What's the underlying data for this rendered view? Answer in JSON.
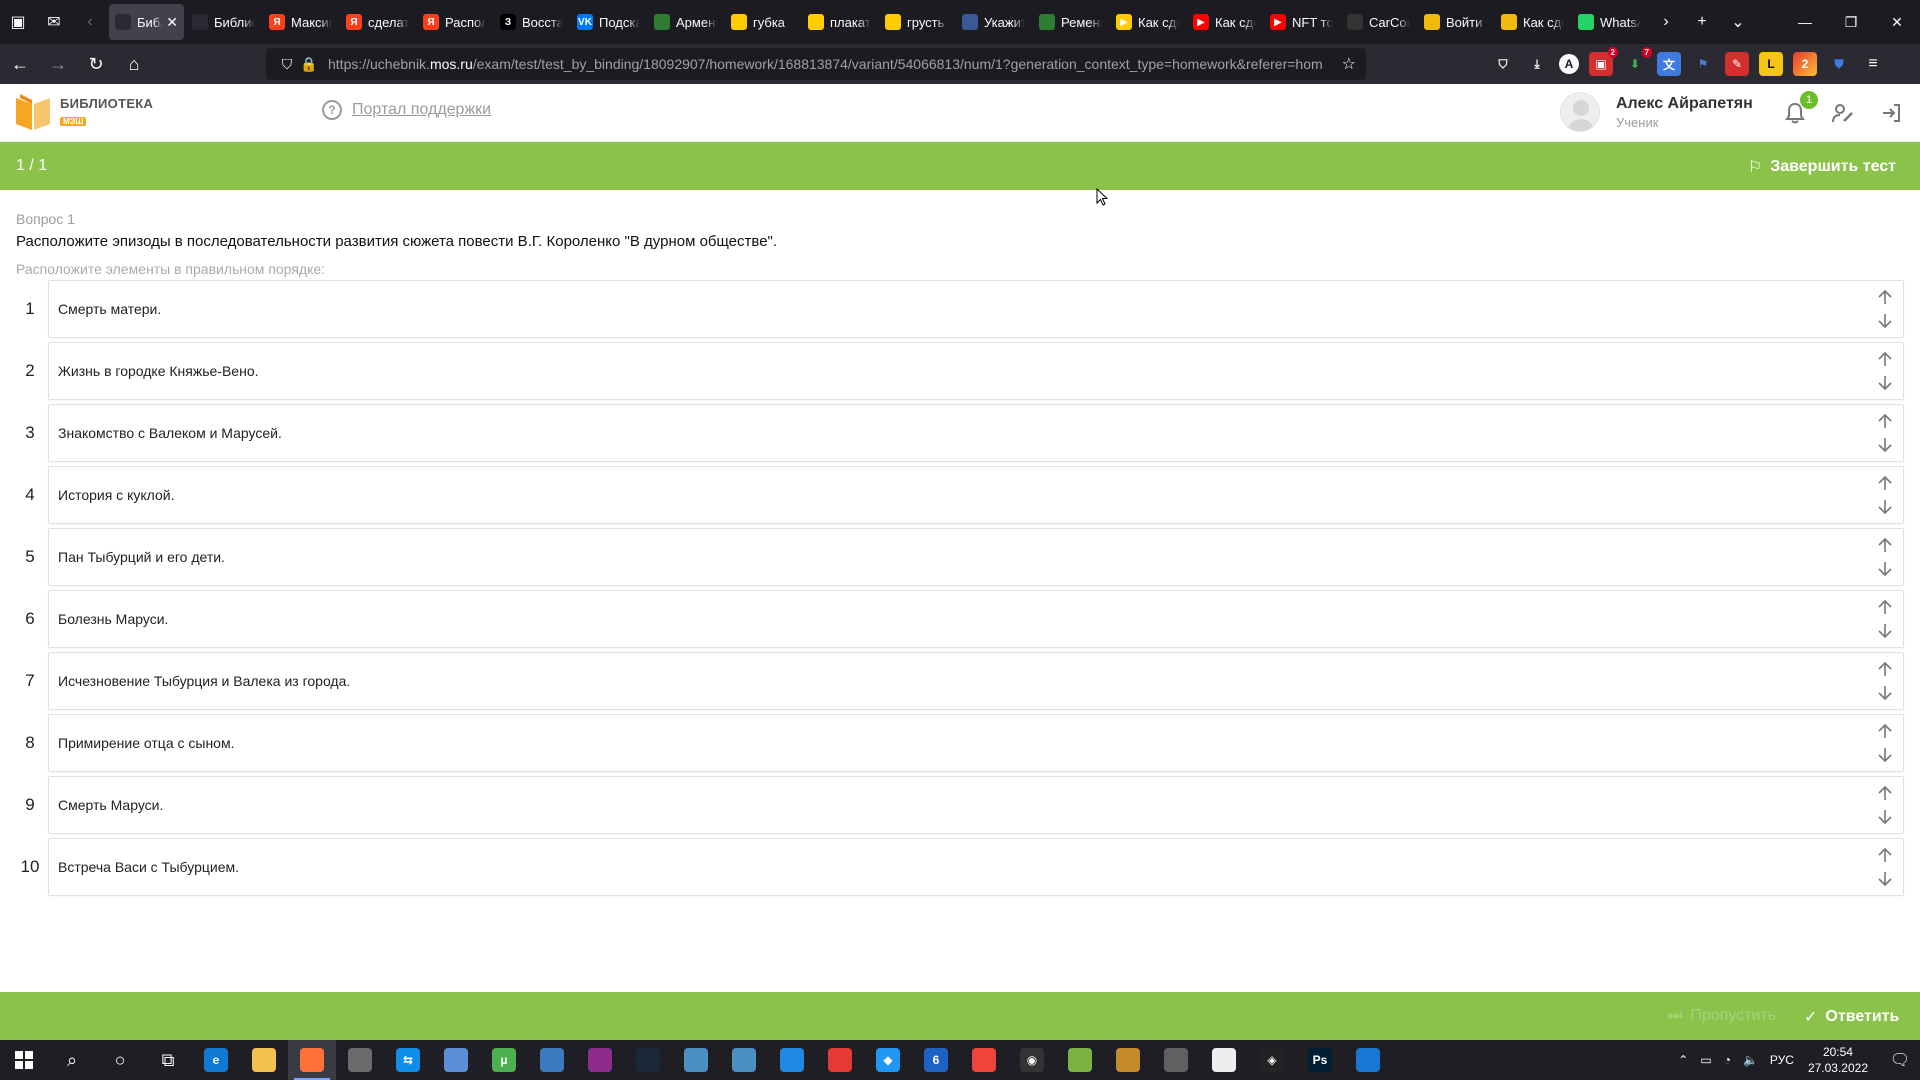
{
  "browser": {
    "tabs": [
      {
        "title": "Библиотека МЭШ",
        "color": "#2a2a35",
        "glyph": "",
        "active": true
      },
      {
        "title": "Библиотека",
        "color": "#2a2a35",
        "glyph": "",
        "active": false
      },
      {
        "title": "Максим",
        "color": "#fc3f1d",
        "glyph": "Я",
        "active": false
      },
      {
        "title": "сделать",
        "color": "#fc3f1d",
        "glyph": "Я",
        "active": false
      },
      {
        "title": "Расположите",
        "color": "#fc3f1d",
        "glyph": "Я",
        "active": false
      },
      {
        "title": "Восстановите",
        "color": "#000000",
        "glyph": "З",
        "active": false
      },
      {
        "title": "Подскажите",
        "color": "#0077ff",
        "glyph": "VK",
        "active": false
      },
      {
        "title": "Армения",
        "color": "#2e7d32",
        "glyph": "",
        "active": false
      },
      {
        "title": "губка",
        "color": "#ffcc00",
        "glyph": "",
        "active": false
      },
      {
        "title": "плакат",
        "color": "#ffcc00",
        "glyph": "",
        "active": false
      },
      {
        "title": "грусть",
        "color": "#ffcc00",
        "glyph": "",
        "active": false
      },
      {
        "title": "Укажите",
        "color": "#3b5998",
        "glyph": "",
        "active": false
      },
      {
        "title": "Ремень",
        "color": "#2e7d32",
        "glyph": "",
        "active": false
      },
      {
        "title": "Как сделать",
        "color": "#ffcc00",
        "glyph": "▶",
        "active": false
      },
      {
        "title": "Как сделать",
        "color": "#ff0000",
        "glyph": "▶",
        "active": false
      },
      {
        "title": "NFT токены",
        "color": "#ff0000",
        "glyph": "▶",
        "active": false
      },
      {
        "title": "CarConnect",
        "color": "#333333",
        "glyph": "",
        "active": false
      },
      {
        "title": "Войти",
        "color": "#f0b90b",
        "glyph": "",
        "active": false
      },
      {
        "title": "Как сделать",
        "color": "#f0b90b",
        "glyph": "",
        "active": false
      },
      {
        "title": "WhatsApp",
        "color": "#25d366",
        "glyph": "",
        "active": false
      }
    ],
    "url_prefix": "https://uchebnik.",
    "url_domain": "mos.ru",
    "url_rest": "/exam/test/test_by_binding/18092907/homework/168813874/variant/54066813/num/1?generation_context_type=homework&referer=hom",
    "extension_badges": [
      "2",
      "7"
    ]
  },
  "header": {
    "logo_title": "БИБЛИОТЕКА",
    "logo_sub": "МЭШ",
    "support_label": "Портал поддержки",
    "user_name": "Алекс Айрапетян",
    "user_role": "Ученик",
    "notification_count": "1"
  },
  "progress": {
    "counter": "1 / 1",
    "finish_label": "Завершить тест"
  },
  "question": {
    "number_label": "Вопрос 1",
    "text": "Расположите эпизоды в последовательности развития сюжета повести В.Г. Короленко \"В дурном обществе\".",
    "hint": "Расположите элементы в правильном порядке:",
    "items": [
      {
        "num": "1",
        "label": "Смерть матери."
      },
      {
        "num": "2",
        "label": "Жизнь в городке Княжье-Вено."
      },
      {
        "num": "3",
        "label": "Знакомство с Валеком и Марусей."
      },
      {
        "num": "4",
        "label": "История с куклой."
      },
      {
        "num": "5",
        "label": "Пан Тыбурций и его дети."
      },
      {
        "num": "6",
        "label": "Болезнь Маруси."
      },
      {
        "num": "7",
        "label": "Исчезновение Тыбурция и Валека из города."
      },
      {
        "num": "8",
        "label": "Примирение отца с сыном."
      },
      {
        "num": "9",
        "label": "Смерть Маруси."
      },
      {
        "num": "10",
        "label": "Встреча Васи с Тыбурцием."
      }
    ]
  },
  "footer": {
    "skip_label": "Пропустить",
    "answer_label": "Ответить"
  },
  "taskbar": {
    "apps": [
      {
        "name": "search",
        "color": "transparent",
        "glyph": "⌕"
      },
      {
        "name": "cortana",
        "color": "transparent",
        "glyph": "○"
      },
      {
        "name": "task-view",
        "color": "transparent",
        "glyph": "⧉"
      },
      {
        "name": "edge",
        "color": "#0f7ad6",
        "glyph": "e"
      },
      {
        "name": "explorer",
        "color": "#f2c14e",
        "glyph": ""
      },
      {
        "name": "firefox",
        "color": "#ff7139",
        "glyph": "",
        "active": true
      },
      {
        "name": "app-1",
        "color": "#6b6b6b",
        "glyph": ""
      },
      {
        "name": "teamviewer",
        "color": "#0e8ee9",
        "glyph": "⇆"
      },
      {
        "name": "app-2",
        "color": "#5a8fd6",
        "glyph": ""
      },
      {
        "name": "utorrent",
        "color": "#4caf50",
        "glyph": "µ"
      },
      {
        "name": "app-3",
        "color": "#3a7bbf",
        "glyph": ""
      },
      {
        "name": "winrar",
        "color": "#8e2c8e",
        "glyph": ""
      },
      {
        "name": "steam",
        "color": "#1b2838",
        "glyph": ""
      },
      {
        "name": "app-4",
        "color": "#4a90c2",
        "glyph": ""
      },
      {
        "name": "calculator",
        "color": "#4a90c2",
        "glyph": ""
      },
      {
        "name": "snip",
        "color": "#1e88e5",
        "glyph": ""
      },
      {
        "name": "chrome",
        "color": "#e53935",
        "glyph": ""
      },
      {
        "name": "app-5",
        "color": "#2196f3",
        "glyph": "◆"
      },
      {
        "name": "word",
        "color": "#1e63c4",
        "glyph": "6"
      },
      {
        "name": "anydesk",
        "color": "#ef443b",
        "glyph": ""
      },
      {
        "name": "obs",
        "color": "#333333",
        "glyph": "◉"
      },
      {
        "name": "app-6",
        "color": "#7cb342",
        "glyph": ""
      },
      {
        "name": "app-7",
        "color": "#c58a2a",
        "glyph": ""
      },
      {
        "name": "app-8",
        "color": "#616161",
        "glyph": ""
      },
      {
        "name": "notepad",
        "color": "#eeeeee",
        "glyph": ""
      },
      {
        "name": "unity",
        "color": "#222222",
        "glyph": "◈"
      },
      {
        "name": "photoshop",
        "color": "#001e36",
        "glyph": "Ps"
      },
      {
        "name": "photos",
        "color": "#1976d2",
        "glyph": ""
      }
    ],
    "lang": "РУС",
    "time": "20:54",
    "date": "27.03.2022"
  },
  "colors": {
    "accent_green": "#8bc34a",
    "browser_dark": "#1c1b22"
  }
}
